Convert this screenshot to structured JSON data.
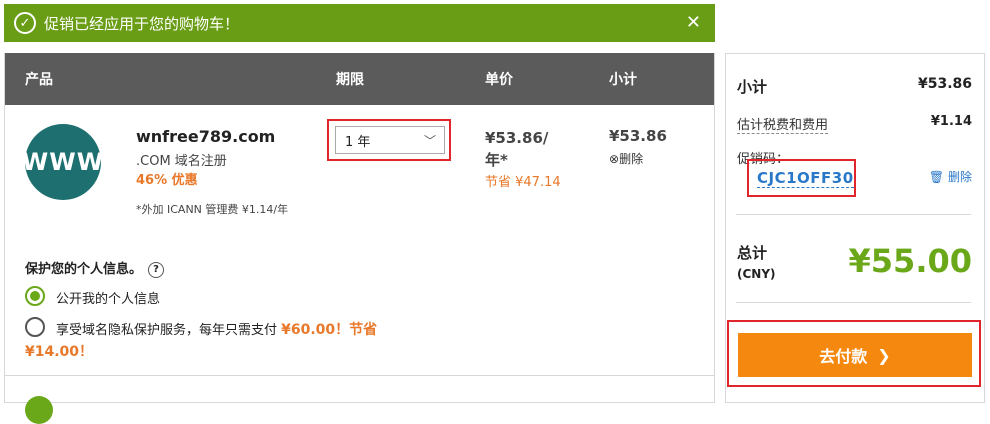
{
  "banner": {
    "message": "促销已经应用于您的购物车！",
    "close": "✕"
  },
  "table": {
    "headers": {
      "product": "产品",
      "term": "期限",
      "unit_price": "单价",
      "subtotal": "小计"
    }
  },
  "item": {
    "logo_text": "WWW",
    "name": "wnfree789.com",
    "type": ".COM 域名注册",
    "discount": "46% 优惠",
    "term": "1 年",
    "unit_price_line1": "¥53.86/",
    "unit_price_line2": "年*",
    "savings": "节省 ¥47.14",
    "subtotal": "¥53.86",
    "remove_label": "删除",
    "icann_note": "*外加 ICANN 管理费 ¥1.14/年"
  },
  "privacy": {
    "title": "保护您的个人信息。",
    "option_public": "公开我的个人信息",
    "option_private_text": "享受域名隐私保护服务，每年只需支付 ",
    "option_private_price": "¥60.00！节省",
    "option_private_line2": "¥14.00！"
  },
  "summary": {
    "subtotal_label": "小计",
    "subtotal_value": "¥53.86",
    "tax_label": "估计税费和费用",
    "tax_value": "¥1.14",
    "promo_label": "促销码：",
    "promo_code": "CJC1OFF30",
    "promo_remove": "删除",
    "total_label": "总计",
    "total_currency": "(CNY)",
    "total_value": "¥55.00",
    "checkout_label": "去付款"
  },
  "colors": {
    "green": "#6a9d16",
    "orange": "#f5880f",
    "highlight": "#e0262b",
    "link": "#2a78c8"
  }
}
